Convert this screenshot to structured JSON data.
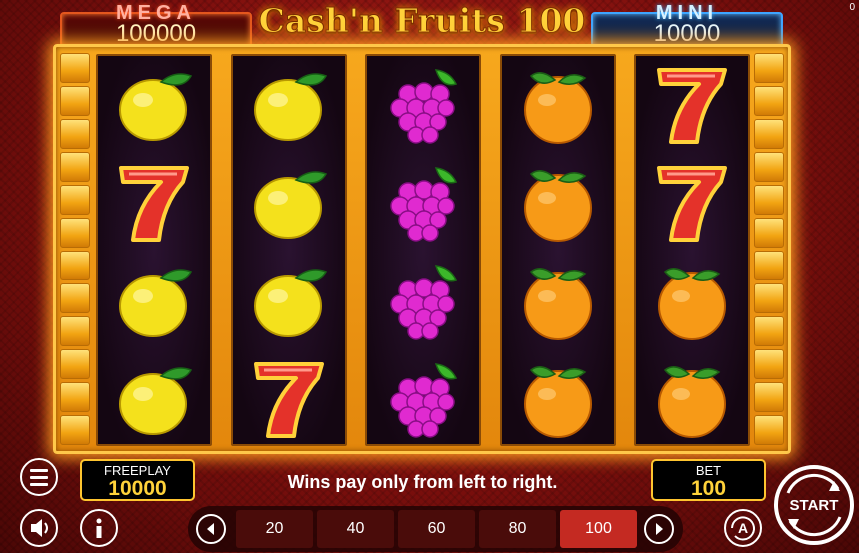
{
  "corner_counter": "0",
  "title": "Cash'n Fruits 100",
  "jackpots": {
    "mega": {
      "label": "MEGA",
      "value": "100000"
    },
    "mini": {
      "label": "MINI",
      "value": "10000"
    }
  },
  "reels": [
    [
      "lemon",
      "seven",
      "lemon",
      "lemon"
    ],
    [
      "lemon",
      "lemon",
      "lemon",
      "seven"
    ],
    [
      "grapes",
      "grapes",
      "grapes",
      "grapes"
    ],
    [
      "orange",
      "orange",
      "orange",
      "orange"
    ],
    [
      "seven",
      "seven",
      "orange",
      "orange"
    ]
  ],
  "freeplay": {
    "label": "FREEPLAY",
    "value": "10000"
  },
  "bet": {
    "label": "BET",
    "value": "100"
  },
  "message": "Wins pay only from left to right.",
  "bet_options": [
    "20",
    "40",
    "60",
    "80",
    "100"
  ],
  "selected_bet": "100",
  "start_label": "START",
  "icons": {
    "menu": "hamburger-menu-icon",
    "sound": "speaker-icon",
    "info": "info-icon",
    "prev": "chevron-left-icon",
    "next": "chevron-right-icon",
    "autoplay": "autoplay-icon",
    "start": "start-spin-icon"
  }
}
